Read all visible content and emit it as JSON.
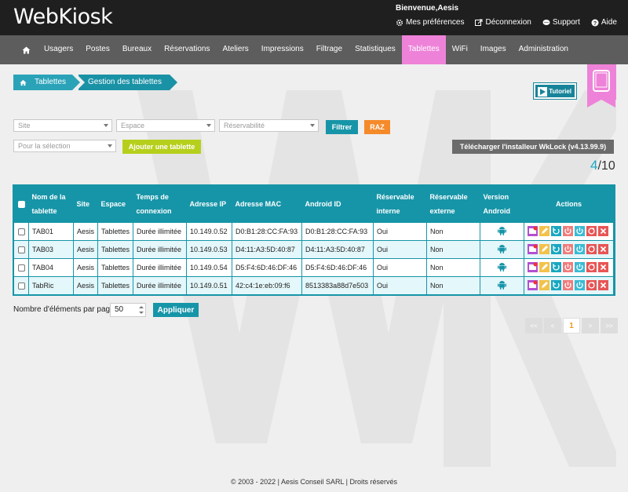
{
  "app": {
    "logo": "WebKiosk"
  },
  "header": {
    "welcome": "Bienvenue,Aesis",
    "links": [
      {
        "label": "Mes préférences",
        "icon": "gear-icon"
      },
      {
        "label": "Déconnexion",
        "icon": "logout-icon"
      },
      {
        "label": "Support",
        "icon": "chat-icon"
      },
      {
        "label": "Aide",
        "icon": "help-icon"
      }
    ]
  },
  "nav": {
    "items": [
      "Usagers",
      "Postes",
      "Bureaux",
      "Réservations",
      "Ateliers",
      "Impressions",
      "Filtrage",
      "Statistiques",
      "Tablettes",
      "WiFi",
      "Images",
      "Administration"
    ],
    "active": "Tablettes"
  },
  "breadcrumb": {
    "items": [
      "Tablettes",
      "Gestion des tablettes"
    ]
  },
  "tutorial": {
    "label": "Tutoriel"
  },
  "filters": {
    "site": "Site",
    "espace": "Espace",
    "reservabilite": "Réservabilité",
    "selection": "Pour la sélection",
    "filtrer": "Filtrer",
    "raz": "RAZ",
    "add": "Ajouter une tablette",
    "download": "Télécharger l'installeur WkLock (v4.13.99.9)"
  },
  "counter": {
    "current": "4",
    "total": "/10"
  },
  "table": {
    "headers": {
      "name": "Nom de la tablette",
      "site": "Site",
      "espace": "Espace",
      "temps": "Temps de connexion",
      "ip": "Adresse IP",
      "mac": "Adresse MAC",
      "android_id": "Android ID",
      "res_int": "Réservable interne",
      "res_ext": "Réservable externe",
      "version": "Version Android",
      "actions": "Actions"
    },
    "rows": [
      {
        "name": "TAB01",
        "site": "Aesis",
        "espace": "Tablettes",
        "temps": "Durée illimitée",
        "ip": "10.149.0.52",
        "mac": "D0:B1:28:CC:FA:93",
        "android_id": "D0:B1:28:CC:FA:93",
        "res_int": "Oui",
        "res_ext": "Non"
      },
      {
        "name": "TAB03",
        "site": "Aesis",
        "espace": "Tablettes",
        "temps": "Durée illimitée",
        "ip": "10.149.0.53",
        "mac": "D4:11:A3:5D:40:87",
        "android_id": "D4:11:A3:5D:40:87",
        "res_int": "Oui",
        "res_ext": "Non"
      },
      {
        "name": "TAB04",
        "site": "Aesis",
        "espace": "Tablettes",
        "temps": "Durée illimitée",
        "ip": "10.149.0.54",
        "mac": "D5:F4:6D:46:DF:46",
        "android_id": "D5:F4:6D:46:DF:46",
        "res_int": "Oui",
        "res_ext": "Non"
      },
      {
        "name": "TabRic",
        "site": "Aesis",
        "espace": "Tablettes",
        "temps": "Durée illimitée",
        "ip": "10.149.0.51",
        "mac": "42:c4:1e:eb:09:f6",
        "android_id": "8513383a88d7e503",
        "res_int": "Oui",
        "res_ext": "Non"
      }
    ]
  },
  "pagination": {
    "perpage_label": "Nombre d'éléments par page",
    "perpage_value": "50",
    "apply": "Appliquer",
    "first": "<<",
    "prev": "<",
    "current": "1",
    "next": ">",
    "last": ">>"
  },
  "footer": "© 2003 - 2022 | Aesis Conseil SARL | Droits réservés",
  "colors": {
    "teal": "#1795a8",
    "pink": "#ee82d8",
    "orange": "#f58a2a",
    "lime": "#b6cf1c",
    "nav": "#5d5d5d",
    "topbar": "#1f1f1f"
  }
}
